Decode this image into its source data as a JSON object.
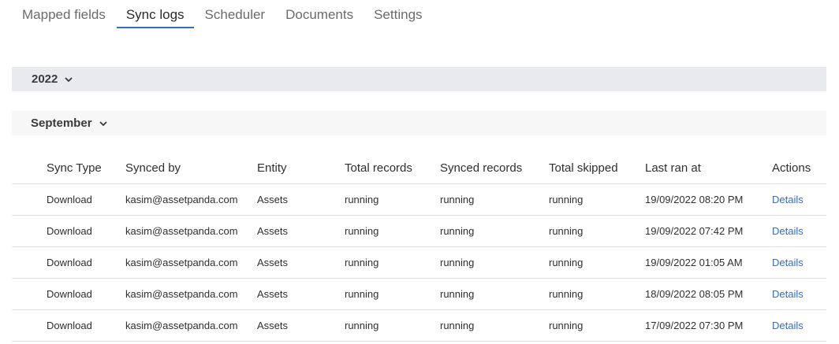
{
  "tabs": [
    {
      "label": "Mapped fields",
      "active": false
    },
    {
      "label": "Sync logs",
      "active": true
    },
    {
      "label": "Scheduler",
      "active": false
    },
    {
      "label": "Documents",
      "active": false
    },
    {
      "label": "Settings",
      "active": false
    }
  ],
  "year_group": {
    "label": "2022",
    "icon": "chevron-down-icon"
  },
  "month_group": {
    "label": "September",
    "icon": "chevron-down-icon"
  },
  "table": {
    "headers": [
      "Sync Type",
      "Synced by",
      "Entity",
      "Total records",
      "Synced records",
      "Total skipped",
      "Last ran at",
      "Actions"
    ],
    "rows": [
      [
        "Download",
        "kasim@assetpanda.com",
        "Assets",
        "running",
        "running",
        "running",
        "19/09/2022 08:20 PM",
        "Details"
      ],
      [
        "Download",
        "kasim@assetpanda.com",
        "Assets",
        "running",
        "running",
        "running",
        "19/09/2022 07:42 PM",
        "Details"
      ],
      [
        "Download",
        "kasim@assetpanda.com",
        "Assets",
        "running",
        "running",
        "running",
        "19/09/2022 01:05 AM",
        "Details"
      ],
      [
        "Download",
        "kasim@assetpanda.com",
        "Assets",
        "running",
        "running",
        "running",
        "18/09/2022 08:05 PM",
        "Details"
      ],
      [
        "Download",
        "kasim@assetpanda.com",
        "Assets",
        "running",
        "running",
        "running",
        "17/09/2022 07:30 PM",
        "Details"
      ]
    ]
  },
  "colors": {
    "accent": "#2f6fc4",
    "year_bar": "#e9eaed",
    "month_bar": "#f7f7f8"
  }
}
